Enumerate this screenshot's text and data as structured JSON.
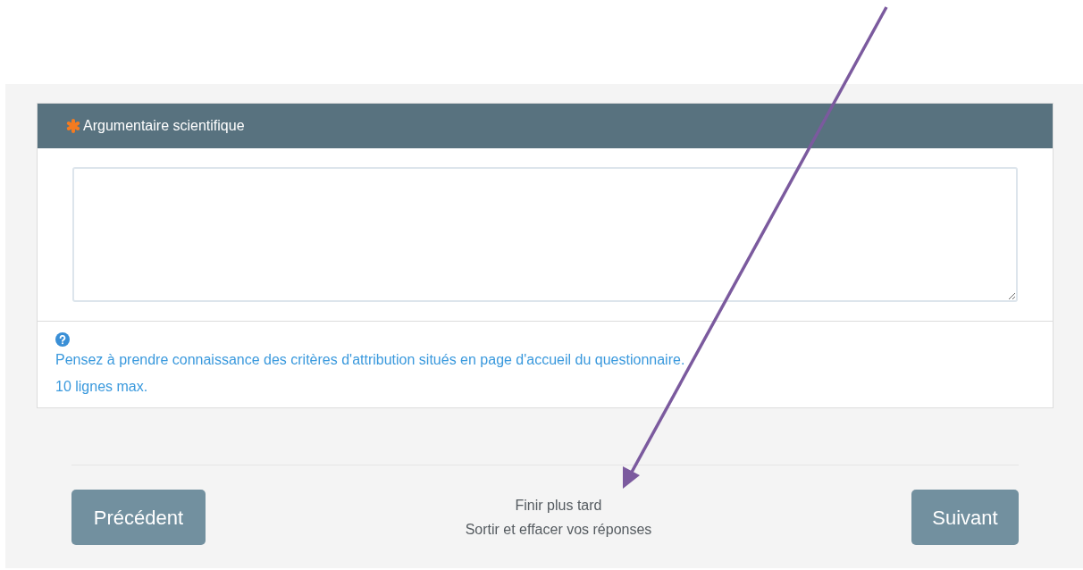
{
  "question": {
    "title": "Argumentaire scientifique",
    "required": true,
    "help": [
      "Pensez à prendre connaissance des critères d'attribution situés en page d'accueil du questionnaire.",
      "10 lignes max."
    ]
  },
  "footer": {
    "previous": "Précédent",
    "links": [
      "Finir plus tard",
      "Sortir et effacer vos réponses"
    ],
    "next": "Suivant"
  }
}
